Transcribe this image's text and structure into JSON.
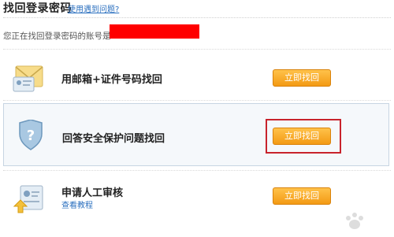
{
  "header": {
    "title": "找回登录密码",
    "help_link": "使用遇到问题?"
  },
  "account": {
    "label": "您正在找回登录密码的账号是:"
  },
  "options": [
    {
      "title": "用邮箱+证件号码找回",
      "button": "立即找回",
      "icon": "id-card-envelope-icon"
    },
    {
      "title": "回答安全保护问题找回",
      "button": "立即找回",
      "icon": "shield-question-icon"
    },
    {
      "title": "申请人工审核",
      "link": "查看教程",
      "button": "立即找回",
      "icon": "document-upload-icon"
    }
  ],
  "colors": {
    "accent_orange": "#f39a14",
    "link_blue": "#2a6fbf",
    "highlight_red": "#c8232c",
    "redaction_red": "#ff0000"
  }
}
